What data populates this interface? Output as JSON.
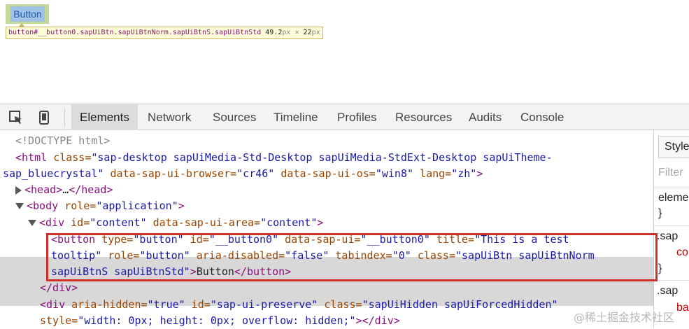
{
  "preview": {
    "button_label": "Button",
    "tooltip": {
      "selector": "button#__button0.sapUiBtn.sapUiBtnNorm.sapUiBtnS.sapUiBtnStd",
      "width": "49.2",
      "width_unit": "px",
      "times": "×",
      "height": "22",
      "height_unit": "px"
    }
  },
  "devtools": {
    "tabs": [
      "Elements",
      "Network",
      "Sources",
      "Timeline",
      "Profiles",
      "Resources",
      "Audits",
      "Console"
    ],
    "active_tab": "Elements",
    "code": {
      "doctype": "<!DOCTYPE html>",
      "html_open": "<html",
      "html_class_attr": "class=",
      "html_class_val": "\"sap-desktop  sapUiMedia-Std-Desktop sapUiMedia-StdExt-Desktop sapUiTheme-",
      "html_class_val2": "sap_bluecrystal\"",
      "html_browser_attr": "data-sap-ui-browser=",
      "html_browser_val": "\"cr46\"",
      "html_os_attr": "data-sap-ui-os=",
      "html_os_val": "\"win8\"",
      "html_lang_attr": "lang=",
      "html_lang_val": "\"zh\"",
      "gt": ">",
      "head_open": "<head>",
      "head_ellipsis": "…",
      "head_close": "</head>",
      "body_open": "<body",
      "body_role_attr": "role=",
      "body_role_val": "\"application\"",
      "div_open": "<div",
      "div_id_attr": "id=",
      "div_id_val": "\"content\"",
      "div_area_attr": "data-sap-ui-area=",
      "div_area_val": "\"content\"",
      "button_open": "<button",
      "btn_type_attr": "type=",
      "btn_type_val": "\"button\"",
      "btn_id_attr": "id=",
      "btn_id_val": "\"__button0\"",
      "btn_ui_attr": "data-sap-ui=",
      "btn_ui_val": "\"__button0\"",
      "btn_title_attr": "title=",
      "btn_title_val": "\"This is a test",
      "btn_title_val2": "tooltip\"",
      "btn_role_attr": "role=",
      "btn_role_val": "\"button\"",
      "btn_aria_attr": "aria-disabled=",
      "btn_aria_val": "\"false\"",
      "btn_tab_attr": "tabindex=",
      "btn_tab_val": "\"0\"",
      "btn_class_attr": "class=",
      "btn_class_val": "\"sapUiBtn sapUiBtnNorm",
      "btn_class_val2": "sapUiBtnS sapUiBtnStd\"",
      "btn_text": "Button",
      "button_close": "</button>",
      "div_close": "</div>",
      "div2_hidden_attr": "aria-hidden=",
      "div2_hidden_val": "\"true\"",
      "div2_id_val": "\"sap-ui-preserve\"",
      "div2_class_val": "\"sapUiHidden sapUiForcedHidden\"",
      "div2_style_attr": "style=",
      "div2_style_val": "\"width: 0px; height: 0px; overflow: hidden;\"",
      "div2_close": "></div>"
    },
    "styles_pane": {
      "tab_label": "Style",
      "filter_placeholder": "Filter",
      "element_label": "eleme",
      "brace_close": "}",
      "rule1_selector": ".sap",
      "rule1_prop": "co",
      "rule1_close": "}",
      "rule2_selector": ".sap",
      "rule2_prop": "ba"
    }
  },
  "watermark": "@稀土掘金技术社区",
  "colors": {
    "tag": "#881280",
    "attr": "#994500",
    "value": "#1a1aa6",
    "highlight_box": "#d0302a",
    "selected_row": "#d8d8d8"
  }
}
